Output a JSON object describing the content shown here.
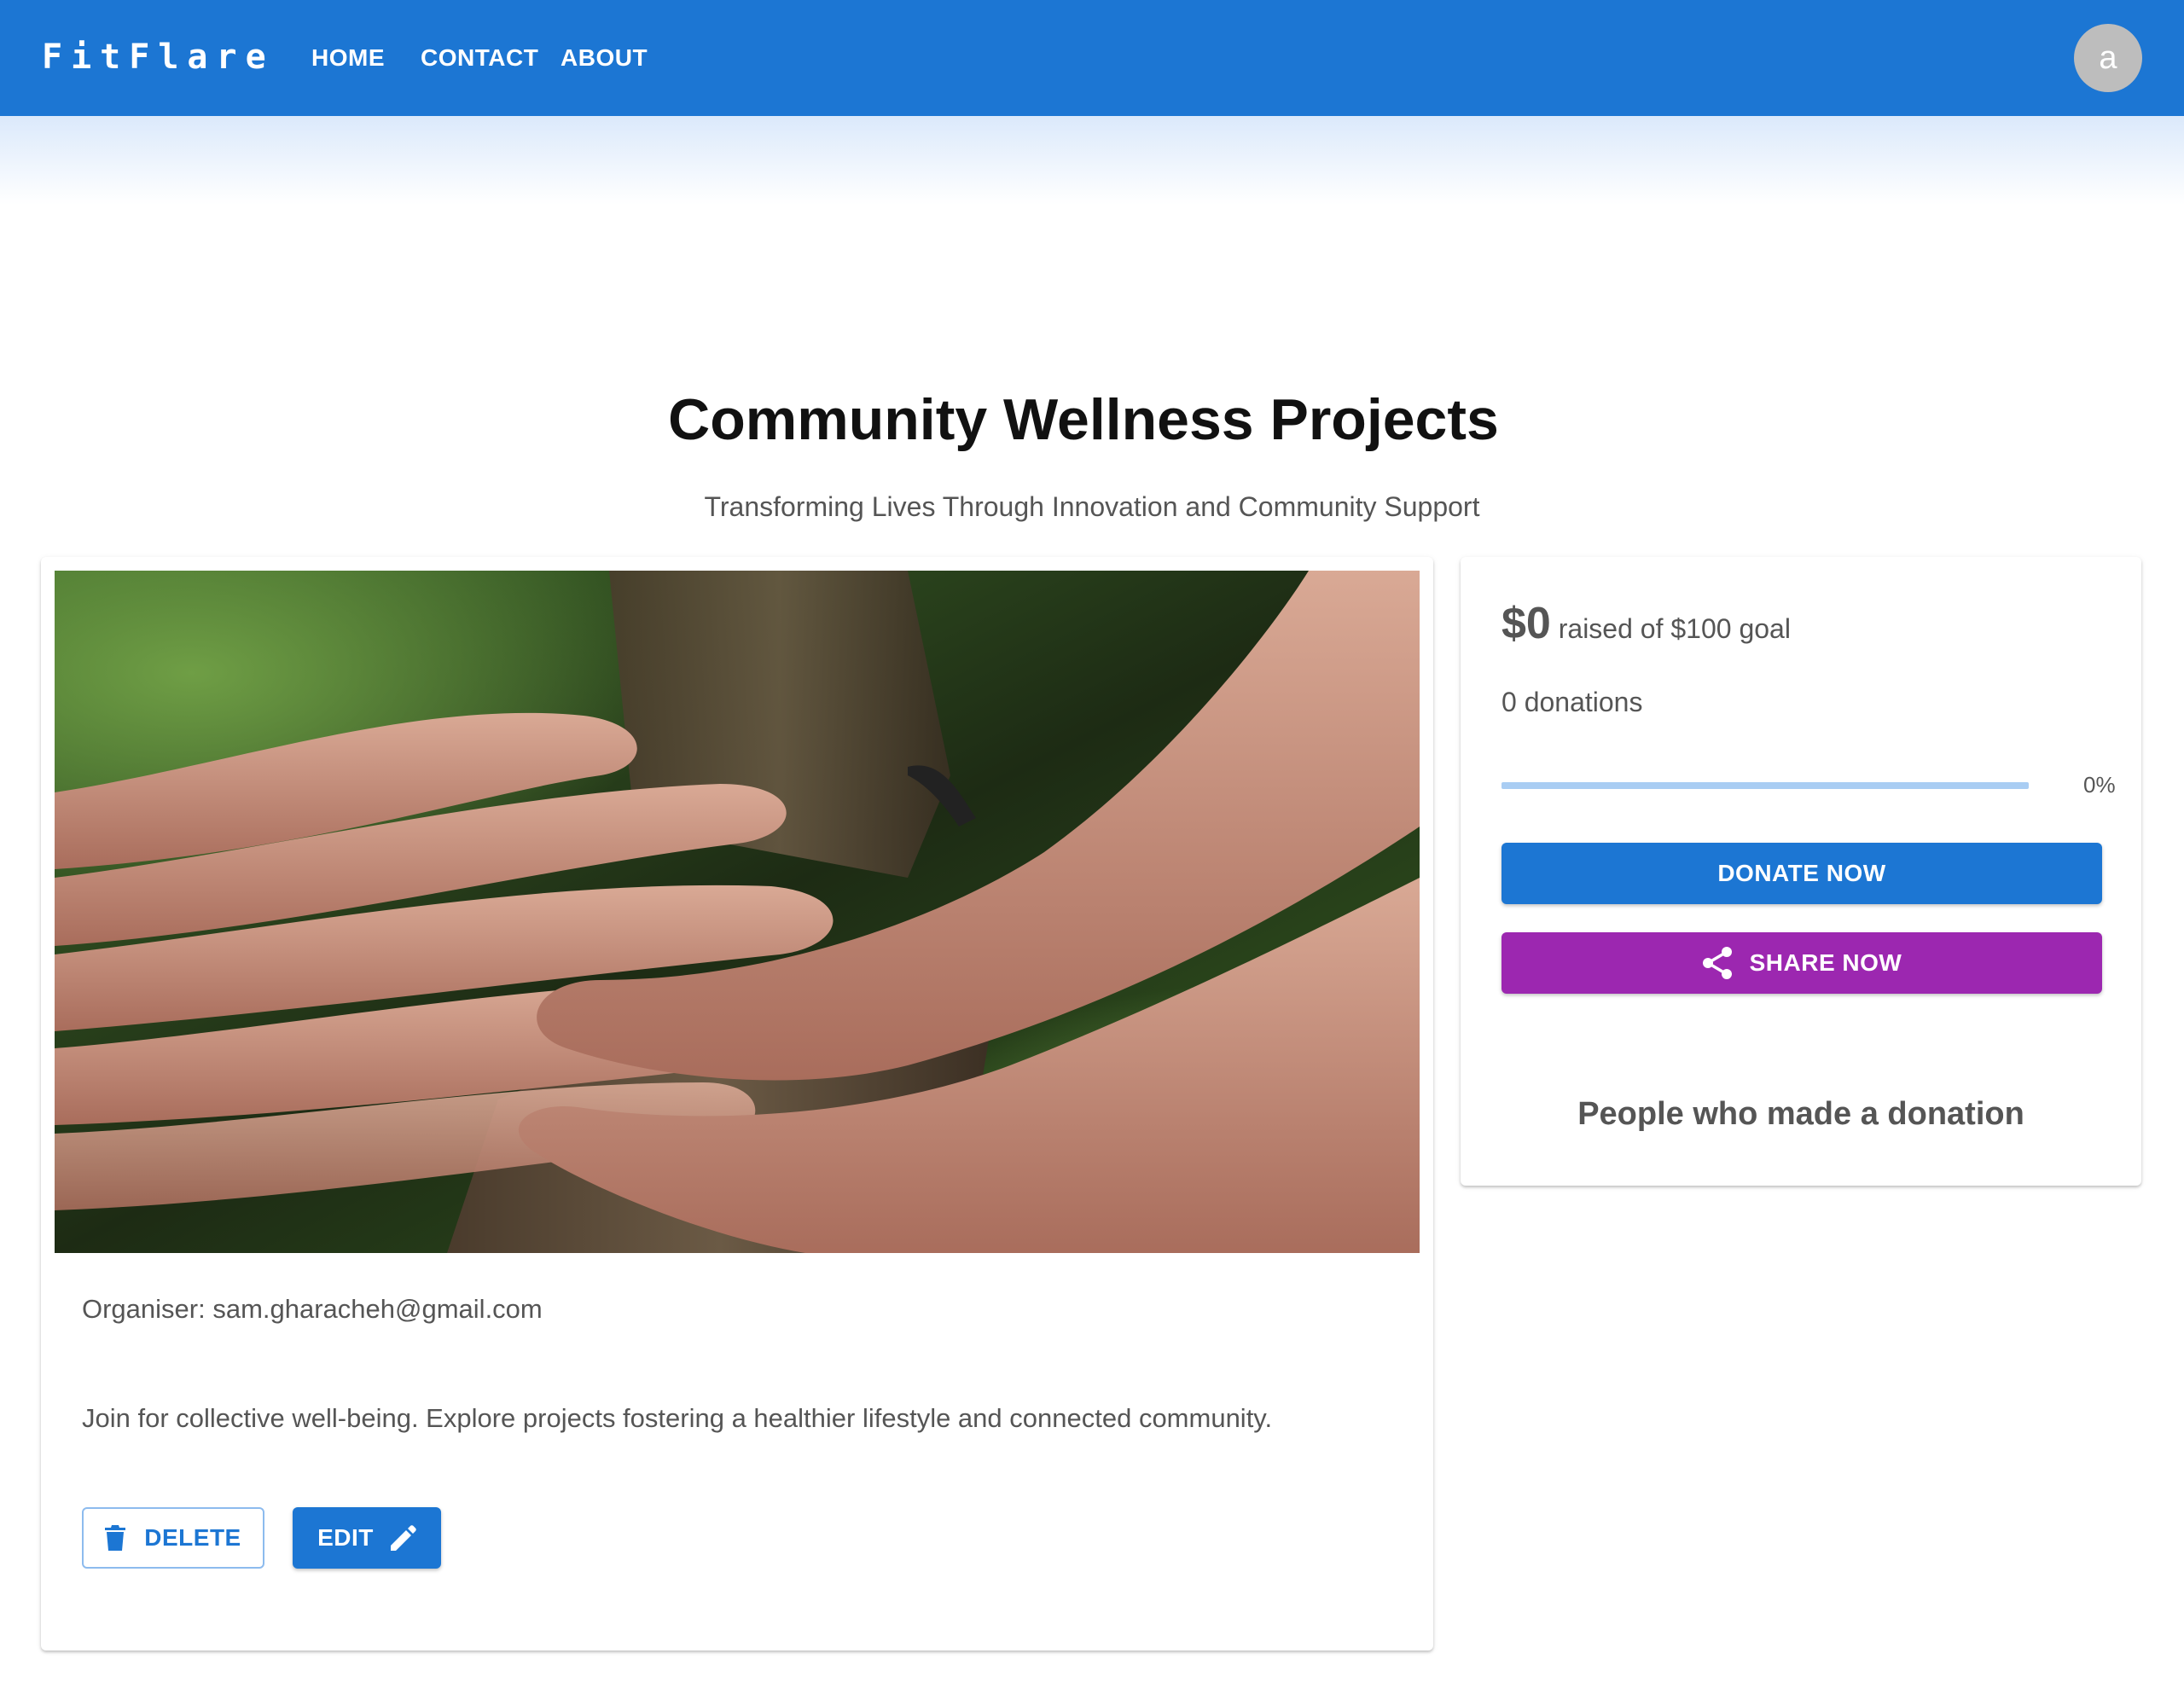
{
  "app": {
    "logo": "FitFlare",
    "nav": [
      {
        "label": "HOME"
      },
      {
        "label": "CONTACT"
      },
      {
        "label": "ABOUT"
      }
    ],
    "avatar_letter": "a"
  },
  "hero": {
    "title": "Community Wellness Projects",
    "subtitle": "Transforming Lives Through Innovation and Community Support"
  },
  "project": {
    "organiser": "Organiser: sam.gharacheh@gmail.com",
    "description": "Join for collective well-being. Explore projects fostering a healthier lifestyle and connected community.",
    "delete_label": "DELETE",
    "edit_label": "EDIT"
  },
  "fundraising": {
    "amount": "$0",
    "goal_text": "raised of $100 goal",
    "donations": "0 donations",
    "progress_fraction": 0,
    "progress_label": "0%",
    "donate_label": "DONATE NOW",
    "share_label": "SHARE NOW",
    "donors_heading": "People who made a donation"
  },
  "icons": {
    "delete": "trash-icon",
    "edit": "pencil-icon",
    "share": "share-icon"
  },
  "colors": {
    "primary": "#1c76d3",
    "secondary": "#9c27b0",
    "avatar": "#bdbdbd"
  }
}
